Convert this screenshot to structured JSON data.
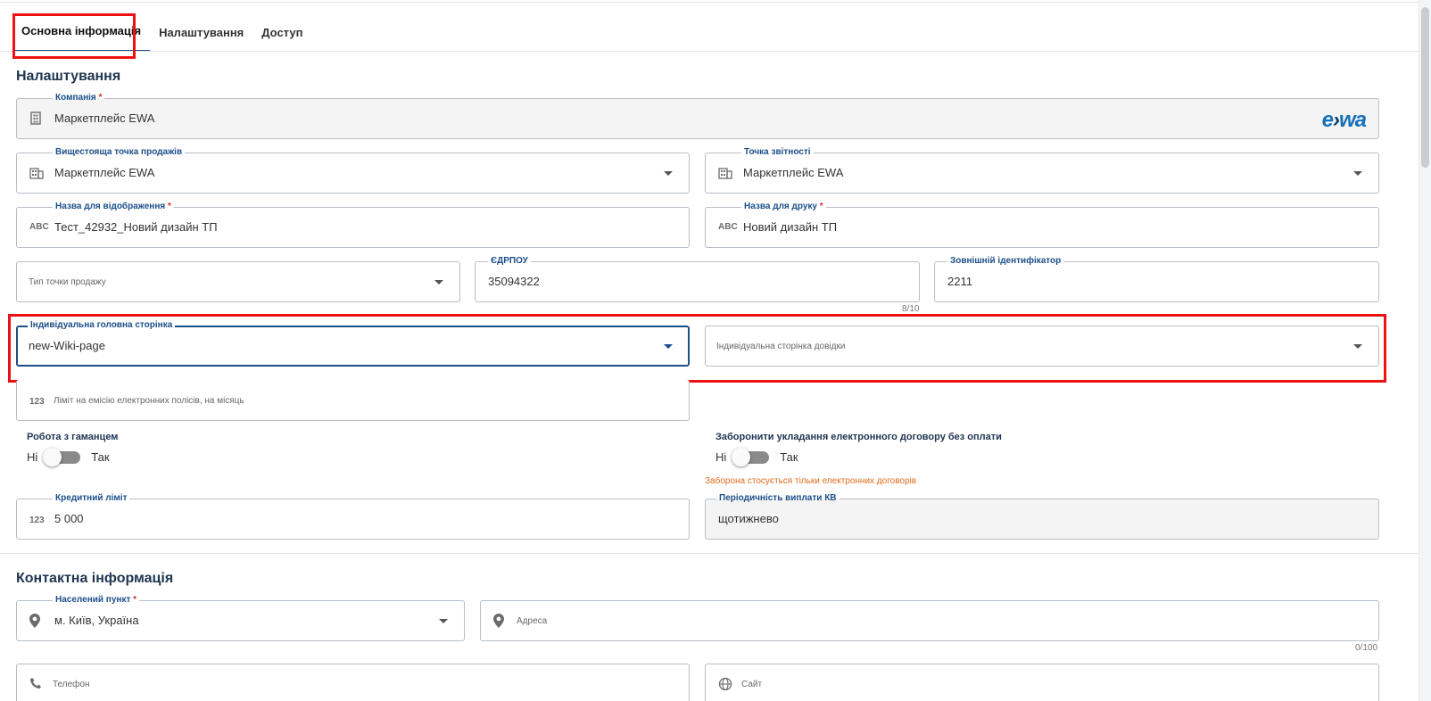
{
  "tabs": [
    {
      "label": "Основна інформація",
      "active": true
    },
    {
      "label": "Налаштування",
      "active": false
    },
    {
      "label": "Доступ",
      "active": false
    }
  ],
  "settings": {
    "title": "Налаштування",
    "company": {
      "label": "Компанія",
      "required": "*",
      "value": "Маркетплейс EWA",
      "icon": "building-icon",
      "logo": "ewa"
    },
    "parent_point": {
      "label": "Вищестояща точка продажів",
      "value": "Маркетплейс EWA",
      "icon": "building-icon"
    },
    "reporting_point": {
      "label": "Точка звітності",
      "value": "Маркетплейс EWA",
      "icon": "building-icon"
    },
    "display_name": {
      "label": "Назва для відображення",
      "required": "*",
      "value": "Тест_42932_Новий дизайн ТП",
      "icon": "ABC"
    },
    "print_name": {
      "label": "Назва для друку",
      "required": "*",
      "value": "Новий дизайн ТП",
      "icon": "ABC"
    },
    "point_type": {
      "placeholder": "Тип точки продажу"
    },
    "edrpou": {
      "label": "ЄДРПОУ",
      "value": "35094322",
      "counter": "8/10"
    },
    "external_id": {
      "label": "Зовнішній ідентифікатор",
      "value": "2211"
    },
    "custom_home_page": {
      "label": "Індивідуальна головна сторінка",
      "value": "new-Wiki-page"
    },
    "custom_help_page": {
      "placeholder": "Індивідуальна сторінка довідки"
    },
    "policy_limit": {
      "placeholder": "Ліміт на емісію електронних полісів, на місяць",
      "icon": "123"
    },
    "wallet": {
      "label": "Робота з гаманцем",
      "off": "Ні",
      "on": "Так",
      "enabled": false
    },
    "forbid_unpaid": {
      "label": "Заборонити укладання електронного договору без оплати",
      "off": "Ні",
      "on": "Так",
      "enabled": false,
      "note": "Заборона стосується тільки електронних договорів"
    },
    "credit_limit": {
      "label": "Кредитний ліміт",
      "value": "5 000",
      "icon": "123"
    },
    "payout_period": {
      "label": "Періодичність виплати КВ",
      "value": "щотижнево"
    }
  },
  "contacts": {
    "title": "Контактна інформація",
    "city": {
      "label": "Населений пункт",
      "required": "*",
      "value": "м. Київ, Україна",
      "icon": "location-pin-icon"
    },
    "address": {
      "placeholder": "Адреса",
      "counter": "0/100",
      "icon": "location-pin-icon"
    },
    "phone": {
      "placeholder": "Телефон",
      "icon": "phone-icon"
    },
    "site": {
      "placeholder": "Сайт",
      "icon": "globe-icon"
    }
  },
  "colors": {
    "accent": "#1b4f8a",
    "highlight": "#ee1111",
    "warning": "#e06a1c"
  }
}
